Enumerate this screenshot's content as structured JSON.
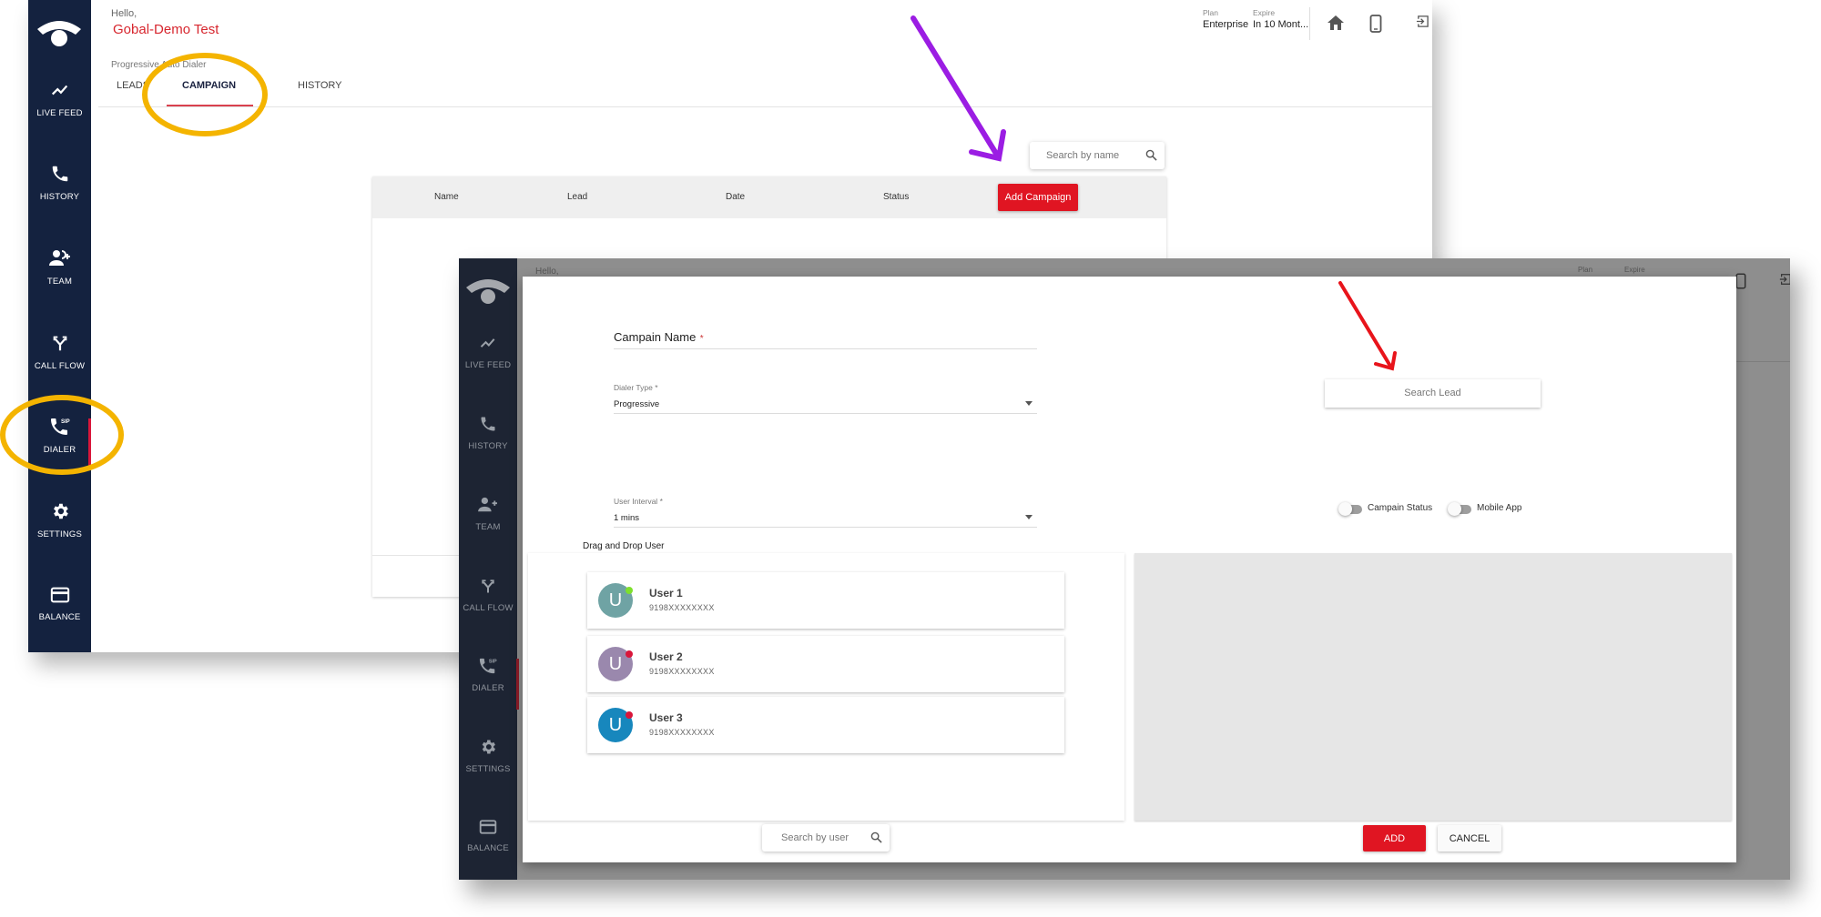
{
  "window_back": {
    "greeting": "Hello,",
    "user_name": "Gobal-Demo Test",
    "subtitle": "Progressive Auto Dialer",
    "tabs": [
      {
        "label": "LEADS",
        "active": false
      },
      {
        "label": "CAMPAIGN",
        "active": true
      },
      {
        "label": "HISTORY",
        "active": false
      }
    ],
    "plan_label": "Plan",
    "plan_value": "Enterprise",
    "expire_label": "Expire",
    "expire_value": "In 10 Mont...",
    "header_icons": [
      "home-icon",
      "mobile-icon",
      "logout-icon"
    ],
    "search": {
      "placeholder": "Search by name"
    },
    "table": {
      "columns": [
        "Name",
        "Lead",
        "Date",
        "Status"
      ],
      "add_button": "Add Campaign",
      "rows": []
    }
  },
  "sidebar": {
    "items": [
      {
        "label": "LIVE FEED",
        "icon": "trend-line-icon"
      },
      {
        "label": "HISTORY",
        "icon": "phone-icon"
      },
      {
        "label": "TEAM",
        "icon": "add-user-icon"
      },
      {
        "label": "CALL FLOW",
        "icon": "fork-arrows-icon"
      },
      {
        "label": "DIALER",
        "icon": "sip-phone-icon",
        "active": true
      },
      {
        "label": "SETTINGS",
        "icon": "gear-icon"
      },
      {
        "label": "BALANCE",
        "icon": "card-icon"
      }
    ]
  },
  "window_front": {
    "greeting": "Hello,",
    "plan_label": "Plan",
    "expire_label": "Expire"
  },
  "modal": {
    "campaign_name": {
      "label": "Campain Name",
      "required": "*",
      "value": ""
    },
    "dialer_type": {
      "label": "Dialer Type",
      "required": "*",
      "value": "Progressive"
    },
    "user_interval": {
      "label": "User Interval",
      "required": "*",
      "value": "1 mins"
    },
    "search_lead": {
      "placeholder": "Search Lead"
    },
    "toggles": [
      {
        "label": "Campain Status",
        "on": false
      },
      {
        "label": "Mobile App",
        "on": false
      }
    ],
    "drag_drop_label": "Drag and Drop User",
    "users": [
      {
        "name": "User 1",
        "phone": "9198XXXXXXXX",
        "initial": "U",
        "avatar_color": "#6fa3a4",
        "status_color": "#7ee02c"
      },
      {
        "name": "User 2",
        "phone": "9198XXXXXXXX",
        "initial": "U",
        "avatar_color": "#9a88ad",
        "status_color": "#d9163a"
      },
      {
        "name": "User 3",
        "phone": "9198XXXXXXXX",
        "initial": "U",
        "avatar_color": "#1787bd",
        "status_color": "#d9163a"
      }
    ],
    "search_user": {
      "placeholder": "Search by user"
    },
    "add_button": "ADD",
    "cancel_button": "CANCEL"
  },
  "colors": {
    "brand_red": "#e01522",
    "sidebar_navy": "#14223f",
    "annotation_purple": "#9b1de3",
    "annotation_red": "#e8141b",
    "annotation_highlight": "#f4b400"
  }
}
